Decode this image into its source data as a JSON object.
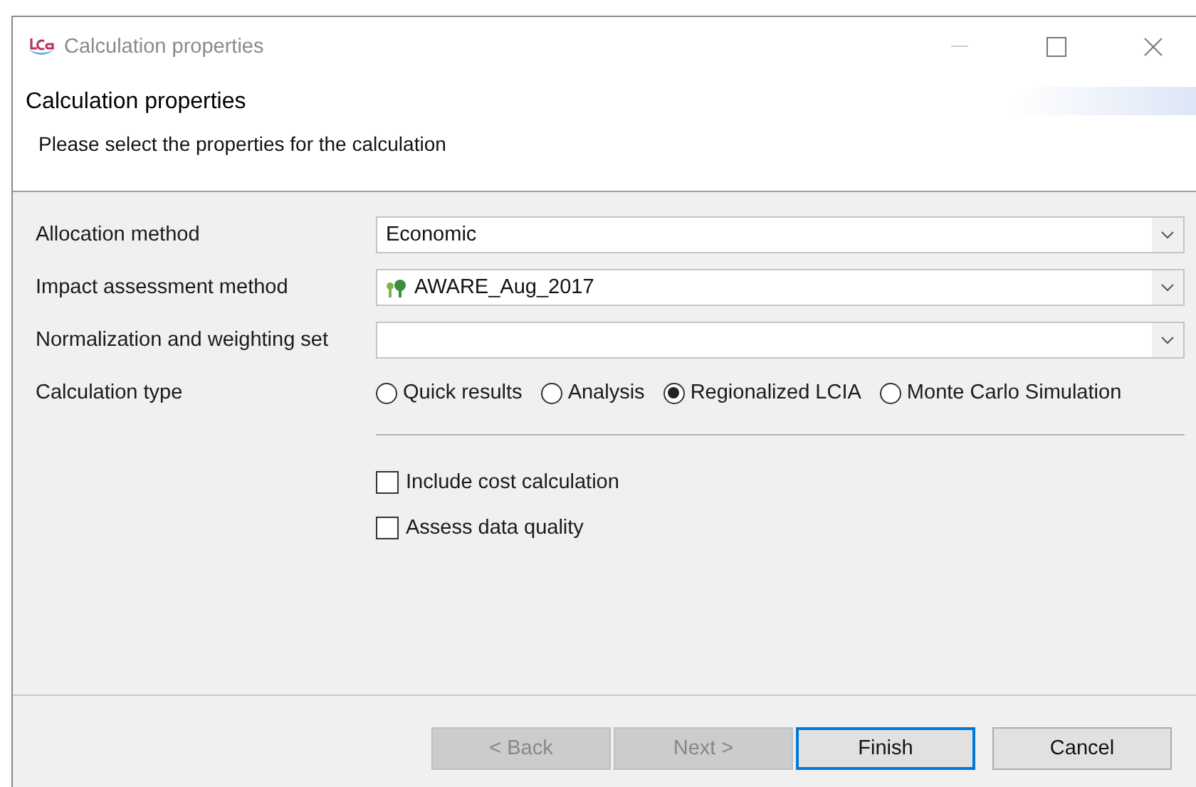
{
  "window": {
    "title": "Calculation properties"
  },
  "header": {
    "title": "Calculation properties",
    "description": "Please select the properties for the calculation"
  },
  "fields": [
    {
      "label": "Allocation method",
      "kind": "combo",
      "value": "Economic"
    },
    {
      "label": "Impact assessment method",
      "kind": "method_combo",
      "value": "AWARE_Aug_2017"
    },
    {
      "label": "Normalization and weighting set",
      "kind": "combo"
    }
  ],
  "calculation_type": {
    "label": "Calculation type",
    "options": [
      {
        "label": "Quick results",
        "selected": false
      },
      {
        "label": "Analysis",
        "selected": false
      },
      {
        "label": "Regionalized LCIA",
        "selected": true
      },
      {
        "label": "Monte Carlo Simulation",
        "selected": false
      }
    ]
  },
  "checkboxes": [
    {
      "label": "Include cost calculation",
      "checked": false
    },
    {
      "label": "Assess data quality",
      "checked": false
    }
  ],
  "buttons": [
    {
      "label": "< Back",
      "disabled": true,
      "default": false
    },
    {
      "label": "Next >",
      "disabled": true,
      "default": false
    },
    {
      "label": "Finish",
      "disabled": false,
      "default": true
    },
    {
      "label": "Cancel",
      "disabled": false,
      "default": false
    }
  ]
}
